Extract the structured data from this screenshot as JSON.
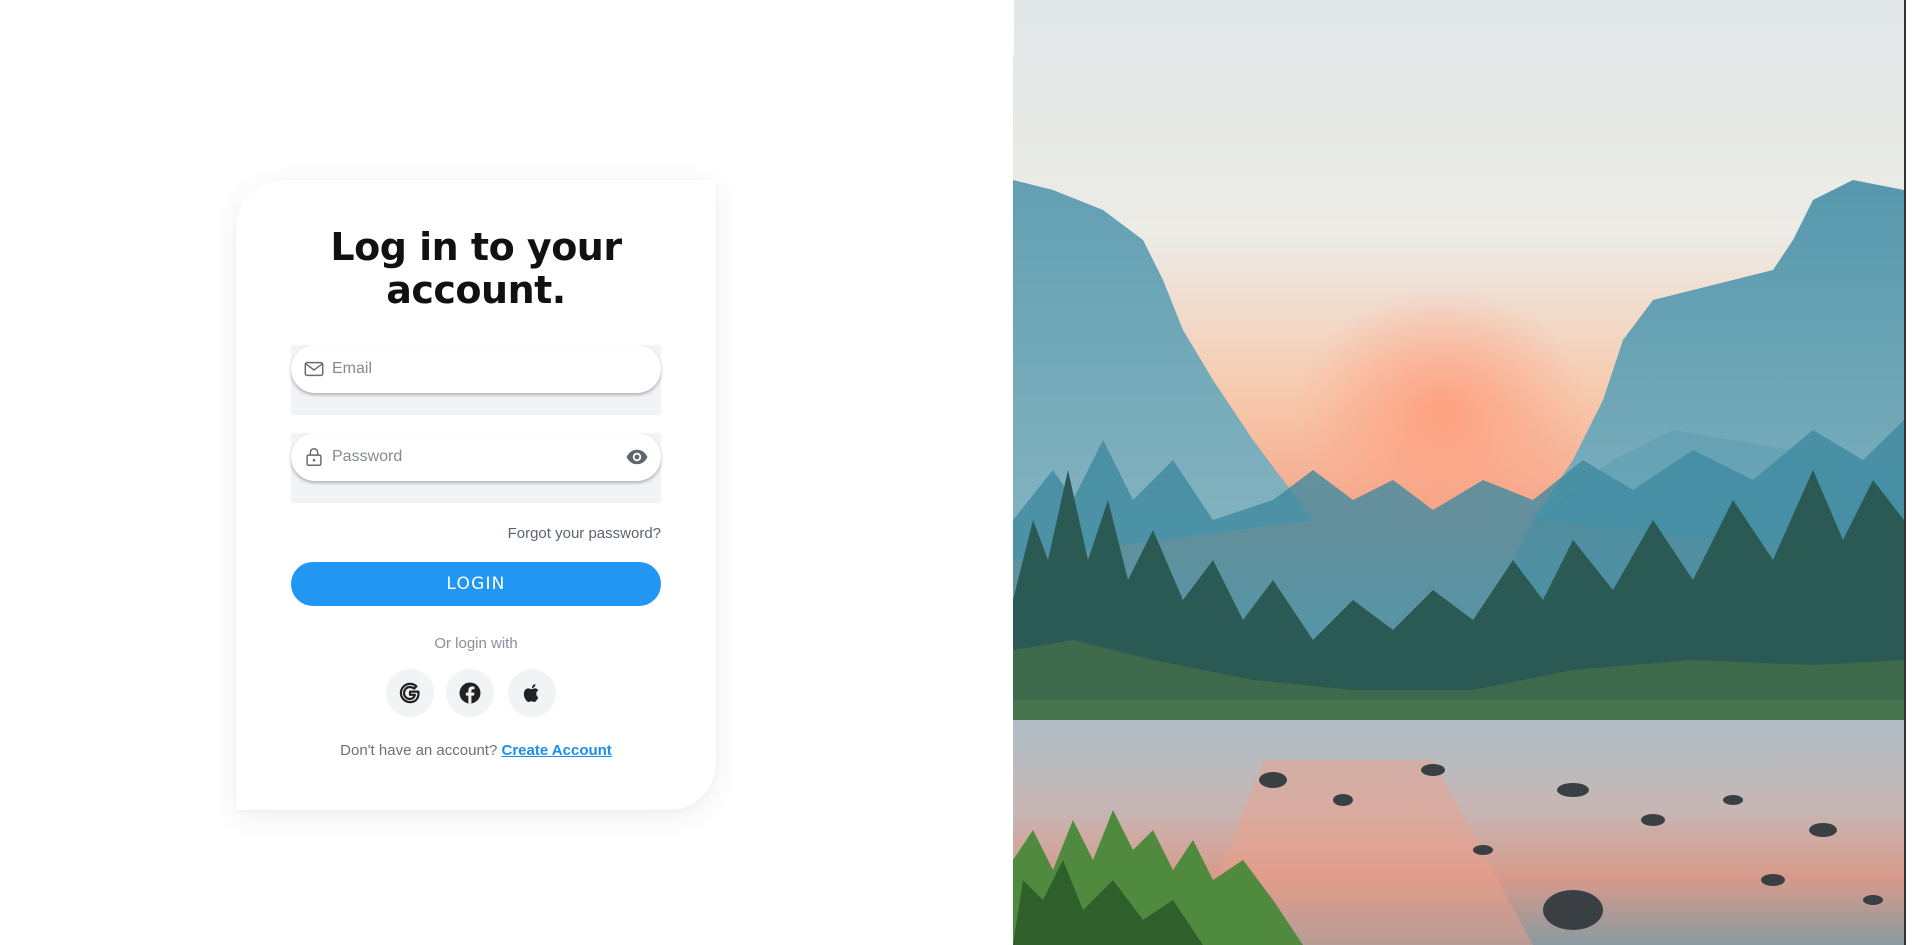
{
  "login": {
    "title_line1": "Log in to your",
    "title_line2": "account.",
    "email": {
      "icon": "mail-icon",
      "value": "",
      "placeholder": "Email"
    },
    "password": {
      "icon": "lock-icon",
      "value": "",
      "placeholder": "Password",
      "toggle_icon": "eye-icon"
    },
    "forgot_password_label": "Forgot your password?",
    "login_button_label": "LOGIN",
    "divider_text": "Or login with",
    "social": [
      {
        "name": "Google",
        "icon": "google-icon"
      },
      {
        "name": "Facebook",
        "icon": "facebook-icon"
      },
      {
        "name": "Apple",
        "icon": "apple-icon"
      }
    ],
    "signup_prompt": "Don't have an account?",
    "signup_link": "Create Account"
  },
  "colors": {
    "accent": "#2196f3",
    "link": "#1a8ef0",
    "text_dark": "#111111",
    "text_muted": "#8a8f98",
    "field_well": "#f2f3f7"
  },
  "hero": {
    "image": "mountain valley at sunset with forest and river"
  }
}
